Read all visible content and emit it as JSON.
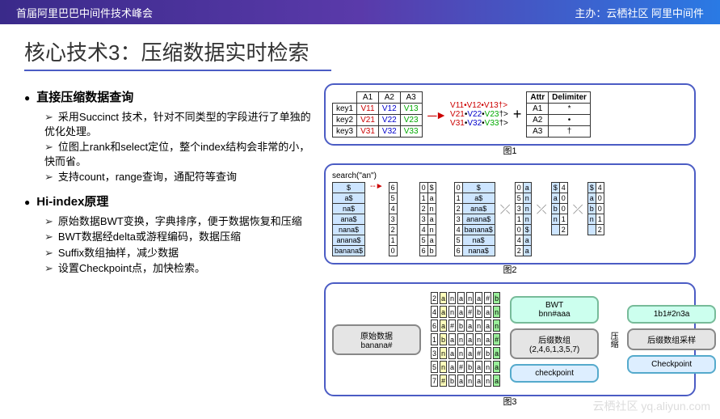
{
  "header": {
    "left": "首届阿里巴巴中间件技术峰会",
    "right": "主办：云栖社区 阿里中间件"
  },
  "title": "核心技术3：压缩数据实时检索",
  "sec1": {
    "h": "直接压缩数据查询",
    "b": [
      "采用Succinct 技术，针对不同类型的字段进行了单独的优化处理。",
      "位图上rank和select定位，整个index结构会非常的小，快而省。",
      "支持count，range查询，通配符等查询"
    ]
  },
  "sec2": {
    "h": "Hi-index原理",
    "b": [
      "原始数据BWT变换，字典排序，便于数据恢复和压缩",
      "BWT数据经delta或游程编码，数据压缩",
      "Suffix数组抽样，减少数据",
      "设置Checkpoint点，加快检索。"
    ]
  },
  "fig1": {
    "cap": "图1",
    "keys": [
      "key1",
      "key2",
      "key3"
    ],
    "cols": [
      "A1",
      "A2",
      "A3"
    ],
    "cells": [
      [
        "V11",
        "V12",
        "V13"
      ],
      [
        "V21",
        "V22",
        "V23"
      ],
      [
        "V31",
        "V32",
        "V33"
      ]
    ],
    "vec": [
      "V11•V12•V13†>",
      "V21•V22•V23†>",
      "V31•V32•V33†>"
    ],
    "attr_h": [
      "Attr",
      "Delimiter"
    ],
    "attr": [
      [
        "A1",
        "*"
      ],
      [
        "A2",
        "•"
      ],
      [
        "A3",
        "†"
      ]
    ]
  },
  "fig2": {
    "cap": "图2",
    "search": "search(\"an\")",
    "suffix": [
      "$",
      "a$",
      "na$",
      "ana$",
      "nana$",
      "anana$",
      "banana$"
    ],
    "idx": [
      "6",
      "5",
      "4",
      "3",
      "2",
      "1",
      "0"
    ],
    "step": {
      "n": [
        "0",
        "1",
        "2",
        "3",
        "4",
        "5",
        "6"
      ],
      "c": [
        "$",
        "a",
        "n",
        "a",
        "n",
        "a",
        "b"
      ]
    },
    "sorted": {
      "n": [
        "0",
        "1",
        "2",
        "3",
        "4",
        "5",
        "6"
      ],
      "s": [
        "$",
        "a$",
        "ana$",
        "anana$",
        "banana$",
        "na$",
        "nana$"
      ]
    },
    "col": {
      "n": [
        "0",
        "5",
        "3",
        "1",
        "0",
        "4",
        "2"
      ],
      "c": [
        "a",
        "n",
        "n",
        "n",
        "$",
        "a",
        "a"
      ]
    },
    "ch": [
      "$",
      "a",
      "b",
      "n"
    ],
    "chn": [
      "4",
      "0",
      "0",
      "1",
      "2"
    ]
  },
  "fig3": {
    "cap": "图3",
    "orig": "原始数据\nbanana#",
    "rows": [
      [
        "2",
        "a",
        "n",
        "a",
        "n",
        "a",
        "#",
        "b"
      ],
      [
        "4",
        "a",
        "n",
        "a",
        "#",
        "b",
        "a",
        "n"
      ],
      [
        "6",
        "a",
        "#",
        "b",
        "a",
        "n",
        "a",
        "n"
      ],
      [
        "1",
        "b",
        "a",
        "n",
        "a",
        "n",
        "a",
        "#"
      ],
      [
        "3",
        "n",
        "a",
        "n",
        "a",
        "#",
        "b",
        "a"
      ],
      [
        "5",
        "n",
        "a",
        "#",
        "b",
        "a",
        "n",
        "a"
      ],
      [
        "7",
        "#",
        "b",
        "a",
        "n",
        "a",
        "n",
        "a"
      ]
    ],
    "bwt": "BWT\nbnn#aaa",
    "suf": "后缀数组\n(2,4,6,1,3,5,7)",
    "cp": "checkpoint",
    "comp": "压缩",
    "enc": "1b1#2n3a",
    "samp": "后缀数组采样",
    "cp2": "Checkpoint"
  },
  "wm": "云栖社区 yq.aliyun.com"
}
